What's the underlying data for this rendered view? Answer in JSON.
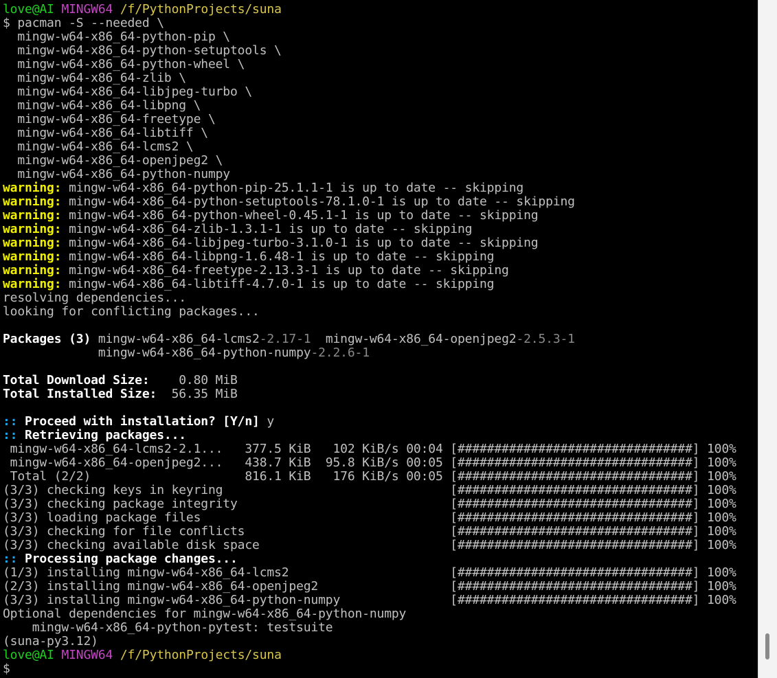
{
  "terminal": {
    "prompt_top": {
      "user": "love@AI",
      "shell": "MINGW64",
      "path": "/f/PythonProjects/suna"
    },
    "command": [
      "$ pacman -S --needed \\",
      "  mingw-w64-x86_64-python-pip \\",
      "  mingw-w64-x86_64-python-setuptools \\",
      "  mingw-w64-x86_64-python-wheel \\",
      "  mingw-w64-x86_64-zlib \\",
      "  mingw-w64-x86_64-libjpeg-turbo \\",
      "  mingw-w64-x86_64-libpng \\",
      "  mingw-w64-x86_64-freetype \\",
      "  mingw-w64-x86_64-libtiff \\",
      "  mingw-w64-x86_64-lcms2 \\",
      "  mingw-w64-x86_64-openjpeg2 \\",
      "  mingw-w64-x86_64-python-numpy"
    ],
    "warning_label": "warning:",
    "warnings": [
      " mingw-w64-x86_64-python-pip-25.1.1-1 is up to date -- skipping",
      " mingw-w64-x86_64-python-setuptools-78.1.0-1 is up to date -- skipping",
      " mingw-w64-x86_64-python-wheel-0.45.1-1 is up to date -- skipping",
      " mingw-w64-x86_64-zlib-1.3.1-1 is up to date -- skipping",
      " mingw-w64-x86_64-libjpeg-turbo-3.1.0-1 is up to date -- skipping",
      " mingw-w64-x86_64-libpng-1.6.48-1 is up to date -- skipping",
      " mingw-w64-x86_64-freetype-2.13.3-1 is up to date -- skipping",
      " mingw-w64-x86_64-libtiff-4.7.0-1 is up to date -- skipping"
    ],
    "resolving": "resolving dependencies...",
    "looking": "looking for conflicting packages...",
    "packages": {
      "label": "Packages (3) ",
      "row1": [
        {
          "name": "mingw-w64-x86_64-lcms2",
          "version": "-2.17-1"
        },
        {
          "name": "  mingw-w64-x86_64-openjpeg2",
          "version": "-2.5.3-1"
        }
      ],
      "row2_indent": "             ",
      "row2": [
        {
          "name": "mingw-w64-x86_64-python-numpy",
          "version": "-2.2.6-1"
        }
      ]
    },
    "sizes": [
      {
        "label": "Total Download Size:",
        "value": "    0.80 MiB"
      },
      {
        "label": "Total Installed Size:",
        "value": "  56.35 MiB"
      }
    ],
    "proceed": {
      "prefix": ":: ",
      "text": "Proceed with installation? [Y/n]",
      "answer": " y"
    },
    "retrieving": {
      "prefix": ":: ",
      "text": "Retrieving packages..."
    },
    "downloads": [
      " mingw-w64-x86_64-lcms2-2.1...   377.5 KiB   102 KiB/s 00:04 [################################] 100%",
      " mingw-w64-x86_64-openjpeg2...   438.7 KiB  95.8 KiB/s 00:05 [################################] 100%",
      " Total (2/2)                     816.1 KiB   176 KiB/s 00:05 [################################] 100%"
    ],
    "checks": [
      "(3/3) checking keys in keyring                               [################################] 100%",
      "(3/3) checking package integrity                             [################################] 100%",
      "(3/3) loading package files                                  [################################] 100%",
      "(3/3) checking for file conflicts                            [################################] 100%",
      "(3/3) checking available disk space                          [################################] 100%"
    ],
    "processing": {
      "prefix": ":: ",
      "text": "Processing package changes..."
    },
    "installs": [
      "(1/3) installing mingw-w64-x86_64-lcms2                      [################################] 100%",
      "(2/3) installing mingw-w64-x86_64-openjpeg2                  [################################] 100%",
      "(3/3) installing mingw-w64-x86_64-python-numpy               [################################] 100%"
    ],
    "optional": "Optional dependencies for mingw-w64-x86_64-python-numpy",
    "optional_item": "    mingw-w64-x86_64-python-pytest: testsuite",
    "venv": "(suna-py3.12)",
    "prompt_bottom": {
      "user": "love@AI",
      "shell": "MINGW64",
      "path": "/f/PythonProjects/suna"
    },
    "cursor_line": "$"
  },
  "colors": {
    "background": "#000000",
    "text": "#c0c0c0",
    "warning": "#f0f000",
    "user": "#1fd11f",
    "shell": "#c247c2",
    "path": "#d9c64b",
    "prefix": "#18a8f0"
  }
}
